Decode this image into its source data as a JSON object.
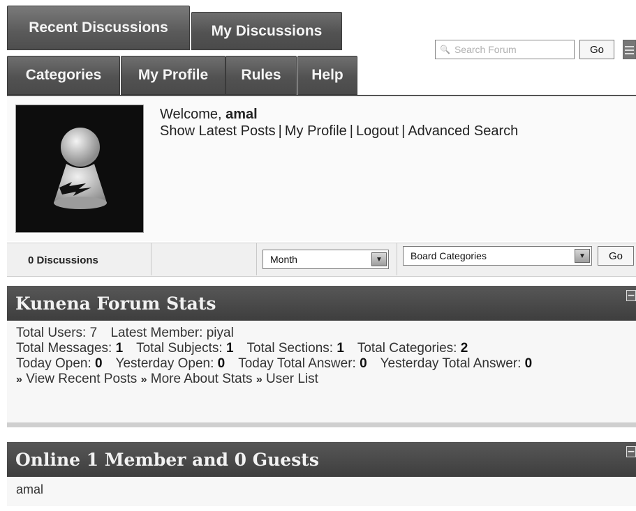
{
  "tabs": {
    "recent": "Recent Discussions",
    "my": "My Discussions",
    "categories": "Categories",
    "profile": "My Profile",
    "rules": "Rules",
    "help": "Help"
  },
  "search": {
    "placeholder": "Search Forum",
    "go": "Go"
  },
  "profile": {
    "welcome_prefix": "Welcome, ",
    "username": "amal",
    "links": [
      "Show Latest Posts",
      "My Profile",
      "Logout",
      "Advanced Search"
    ]
  },
  "filters": {
    "discussions": "0 Discussions",
    "period": "Month",
    "category": "Board Categories",
    "go": "Go"
  },
  "stats": {
    "title": "Kunena Forum Stats",
    "total_users_label": "Total Users:",
    "total_users": "7",
    "latest_member_label": "Latest Member:",
    "latest_member": "piyal",
    "total_messages_label": "Total Messages:",
    "total_messages": "1",
    "total_subjects_label": "Total Subjects:",
    "total_subjects": "1",
    "total_sections_label": "Total Sections:",
    "total_sections": "1",
    "total_categories_label": "Total Categories:",
    "total_categories": "2",
    "today_open_label": "Today Open:",
    "today_open": "0",
    "yesterday_open_label": "Yesterday Open:",
    "yesterday_open": "0",
    "today_answer_label": "Today Total Answer:",
    "today_answer": "0",
    "yesterday_answer_label": "Yesterday Total Answer:",
    "yesterday_answer": "0",
    "links": [
      "View Recent Posts",
      "More About Stats",
      "User List"
    ]
  },
  "online": {
    "title": "Online 1 Member and 0 Guests",
    "members": "amal"
  },
  "collapse_glyph": "−",
  "quick_link_glyph": "»",
  "link_separator": "|",
  "dropdown_glyph": "▼",
  "search_glyph": "🔍",
  "colors": {
    "tab_bg": "#555555",
    "header_bg": "#4a4a4a",
    "body_bg": "#f7f7f7"
  }
}
